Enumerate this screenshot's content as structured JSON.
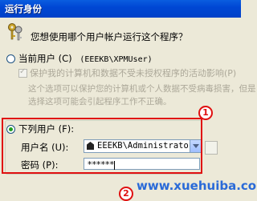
{
  "window": {
    "title": "运行身份"
  },
  "dialog": {
    "question": "您想使用哪个用户帐户运行这个程序？",
    "current_user": {
      "label": "当前用户 (C)",
      "account": "(EEEKB\\XPMUser)",
      "protect_checkbox_label": "保护我的计算机和数据不受未授权程序的活动影响(P)",
      "note_line1": "这个选项可以保护您的计算机或个人数据不受病毒损害，但是",
      "note_line2": "选择这项可能会引起程序工作不正确。"
    },
    "following_user": {
      "label": "下列用户 (F):",
      "username_label": "用户名 (U):",
      "username_value": "EEEKB\\Administrator",
      "password_label": "密码 (P):",
      "password_value": "******"
    }
  },
  "annotations": {
    "callout_1": "1",
    "callout_2": "2"
  },
  "watermark": "www.xuehuiba.com"
}
